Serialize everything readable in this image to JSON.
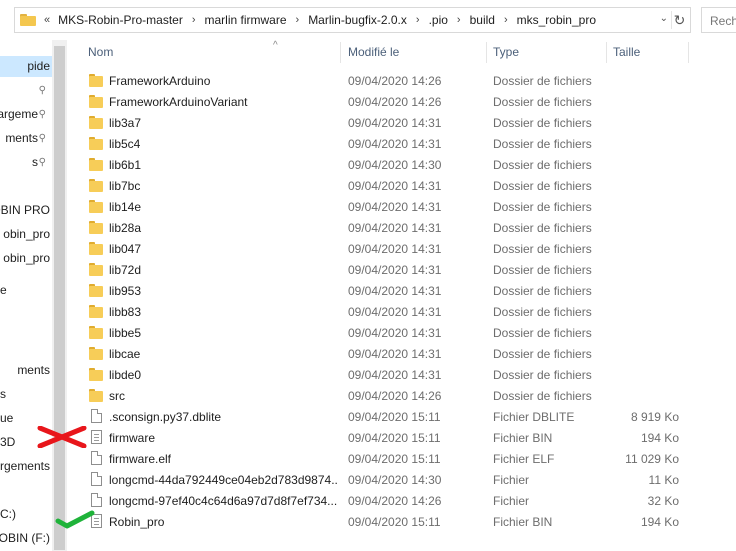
{
  "address_bar": {
    "overflow_marker": "«",
    "crumbs": [
      "MKS-Robin-Pro-master",
      "marlin firmware",
      "Marlin-bugfix-2.0.x",
      ".pio",
      "build",
      "mks_robin_pro"
    ],
    "dropdown_glyph": "⌄",
    "refresh_glyph": "↻"
  },
  "search": {
    "placeholder": "Rech"
  },
  "nav": {
    "items": [
      {
        "label": "pide",
        "selected": true,
        "pinned": false
      },
      {
        "label": "",
        "selected": false,
        "pinned": true
      },
      {
        "label": "argeme",
        "selected": false,
        "pinned": true
      },
      {
        "label": "ments",
        "selected": false,
        "pinned": true
      },
      {
        "label": "s",
        "selected": false,
        "pinned": true
      },
      {
        "label": "",
        "selected": false,
        "pinned": false
      },
      {
        "label": "ROBIN PRO",
        "selected": false,
        "pinned": false
      },
      {
        "label": "obin_pro",
        "selected": false,
        "pinned": false
      },
      {
        "label": "obin_pro",
        "selected": false,
        "pinned": false
      },
      {
        "label": "e",
        "selected": false,
        "pinned": false
      },
      {
        "label": "",
        "selected": false,
        "pinned": false
      },
      {
        "label": "",
        "selected": false,
        "pinned": false
      },
      {
        "label": "ments",
        "selected": false,
        "pinned": false
      },
      {
        "label": "s",
        "selected": false,
        "pinned": false
      },
      {
        "label": "ue",
        "selected": false,
        "pinned": false
      },
      {
        "label": "3D",
        "selected": false,
        "pinned": false
      },
      {
        "label": "argements",
        "selected": false,
        "pinned": false
      },
      {
        "label": "",
        "selected": false,
        "pinned": false
      },
      {
        "label": "C:)",
        "selected": false,
        "pinned": false
      },
      {
        "label": "OBIN (F:)",
        "selected": false,
        "pinned": false
      }
    ],
    "pin_glyph": "📌"
  },
  "columns": {
    "sort_glyph": "^",
    "name": "Nom",
    "date": "Modifié le",
    "type": "Type",
    "size": "Taille"
  },
  "files": [
    {
      "name": "FrameworkArduino",
      "date": "09/04/2020 14:26",
      "type": "Dossier de fichiers",
      "size": "",
      "icon": "folder-icon"
    },
    {
      "name": "FrameworkArduinoVariant",
      "date": "09/04/2020 14:26",
      "type": "Dossier de fichiers",
      "size": "",
      "icon": "folder-icon"
    },
    {
      "name": "lib3a7",
      "date": "09/04/2020 14:31",
      "type": "Dossier de fichiers",
      "size": "",
      "icon": "folder-icon"
    },
    {
      "name": "lib5c4",
      "date": "09/04/2020 14:31",
      "type": "Dossier de fichiers",
      "size": "",
      "icon": "folder-icon"
    },
    {
      "name": "lib6b1",
      "date": "09/04/2020 14:30",
      "type": "Dossier de fichiers",
      "size": "",
      "icon": "folder-icon"
    },
    {
      "name": "lib7bc",
      "date": "09/04/2020 14:31",
      "type": "Dossier de fichiers",
      "size": "",
      "icon": "folder-icon"
    },
    {
      "name": "lib14e",
      "date": "09/04/2020 14:31",
      "type": "Dossier de fichiers",
      "size": "",
      "icon": "folder-icon"
    },
    {
      "name": "lib28a",
      "date": "09/04/2020 14:31",
      "type": "Dossier de fichiers",
      "size": "",
      "icon": "folder-icon"
    },
    {
      "name": "lib047",
      "date": "09/04/2020 14:31",
      "type": "Dossier de fichiers",
      "size": "",
      "icon": "folder-icon"
    },
    {
      "name": "lib72d",
      "date": "09/04/2020 14:31",
      "type": "Dossier de fichiers",
      "size": "",
      "icon": "folder-icon"
    },
    {
      "name": "lib953",
      "date": "09/04/2020 14:31",
      "type": "Dossier de fichiers",
      "size": "",
      "icon": "folder-icon"
    },
    {
      "name": "libb83",
      "date": "09/04/2020 14:31",
      "type": "Dossier de fichiers",
      "size": "",
      "icon": "folder-icon"
    },
    {
      "name": "libbe5",
      "date": "09/04/2020 14:31",
      "type": "Dossier de fichiers",
      "size": "",
      "icon": "folder-icon"
    },
    {
      "name": "libcae",
      "date": "09/04/2020 14:31",
      "type": "Dossier de fichiers",
      "size": "",
      "icon": "folder-icon"
    },
    {
      "name": "libde0",
      "date": "09/04/2020 14:31",
      "type": "Dossier de fichiers",
      "size": "",
      "icon": "folder-icon"
    },
    {
      "name": "src",
      "date": "09/04/2020 14:26",
      "type": "Dossier de fichiers",
      "size": "",
      "icon": "folder-icon"
    },
    {
      "name": ".sconsign.py37.dblite",
      "date": "09/04/2020 15:11",
      "type": "Fichier DBLITE",
      "size": "8 919 Ko",
      "icon": "file-icon"
    },
    {
      "name": "firmware",
      "date": "09/04/2020 15:11",
      "type": "Fichier BIN",
      "size": "194 Ko",
      "icon": "binary-file-icon"
    },
    {
      "name": "firmware.elf",
      "date": "09/04/2020 15:11",
      "type": "Fichier ELF",
      "size": "11 029 Ko",
      "icon": "file-icon"
    },
    {
      "name": "longcmd-44da792449ce04eb2d783d9874...",
      "date": "09/04/2020 14:30",
      "type": "Fichier",
      "size": "11 Ko",
      "icon": "file-icon"
    },
    {
      "name": "longcmd-97ef40c4c64d6a97d7d8f7ef734...",
      "date": "09/04/2020 14:26",
      "type": "Fichier",
      "size": "32 Ko",
      "icon": "file-icon"
    },
    {
      "name": "Robin_pro",
      "date": "09/04/2020 15:11",
      "type": "Fichier BIN",
      "size": "194 Ko",
      "icon": "binary-file-icon"
    }
  ],
  "annotations": {
    "wrong_mark_color": "#e8161b",
    "right_mark_color": "#1fb33a"
  },
  "colors": {
    "selection": "#cce8ff",
    "header_text": "#4c607a",
    "folder": "#f7cd58"
  }
}
